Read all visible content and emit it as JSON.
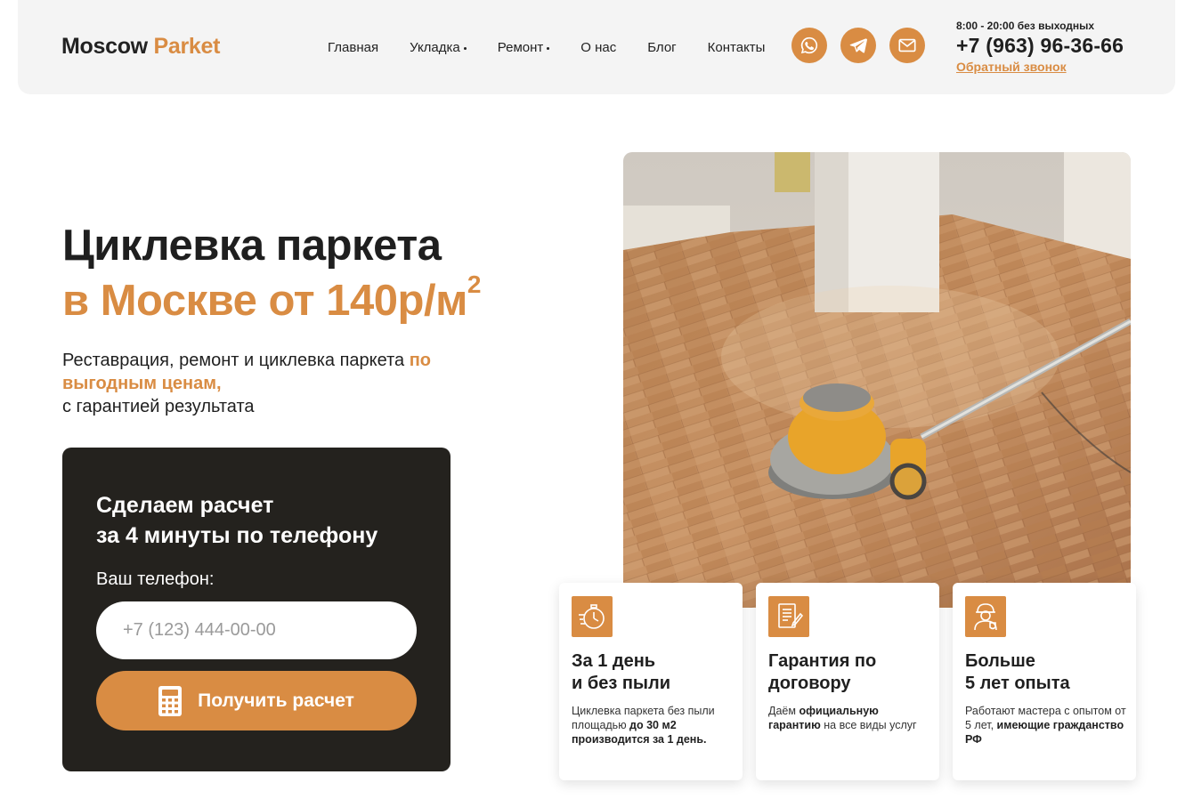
{
  "header": {
    "logo_part1": "Moscow",
    "logo_part2": "Parket",
    "nav": [
      {
        "label": "Главная",
        "has_dropdown": false
      },
      {
        "label": "Укладка",
        "has_dropdown": true
      },
      {
        "label": "Ремонт",
        "has_dropdown": true
      },
      {
        "label": "О нас",
        "has_dropdown": false
      },
      {
        "label": "Блог",
        "has_dropdown": false
      },
      {
        "label": "Контакты",
        "has_dropdown": false
      }
    ],
    "socials": [
      "whatsapp-icon",
      "telegram-icon",
      "mail-icon"
    ],
    "hours": "8:00 - 20:00 без выходных",
    "phone": "+7 (963) 96-36-66",
    "callback": "Обратный звонок"
  },
  "hero": {
    "title_line1": "Циклевка паркета",
    "title_line2": "в Москве от 140р/м",
    "title_sup": "2",
    "subtitle_part1": "Реставрация, ремонт и циклевка паркета ",
    "subtitle_accent": "по выгодным ценам,",
    "subtitle_part2": "с гарантией результата"
  },
  "form": {
    "title_line1": "Сделаем расчет",
    "title_line2": "за 4 минуты по телефону",
    "label": "Ваш телефон:",
    "placeholder": "+7 (123) 444-00-00",
    "button": "Получить расчет"
  },
  "features": [
    {
      "icon": "stopwatch-icon",
      "title_line1": "За 1 день",
      "title_line2": "и без пыли",
      "text_plain": "Циклевка паркета без пыли площадью ",
      "text_bold": "до 30 м2 производится за 1 день.",
      "text_after": ""
    },
    {
      "icon": "contract-icon",
      "title_line1": "Гарантия по",
      "title_line2": "договору",
      "text_plain": "Даём ",
      "text_bold": "официальную гарантию",
      "text_after": " на все виды услуг"
    },
    {
      "icon": "worker-icon",
      "title_line1": "Больше",
      "title_line2": "5 лет опыта",
      "text_plain": "Работают мастера с опытом от 5 лет, ",
      "text_bold": "имеющие гражданство РФ",
      "text_after": ""
    }
  ],
  "colors": {
    "accent": "#d98c43",
    "dark_card": "#24221e",
    "header_bg": "#f4f4f4"
  }
}
